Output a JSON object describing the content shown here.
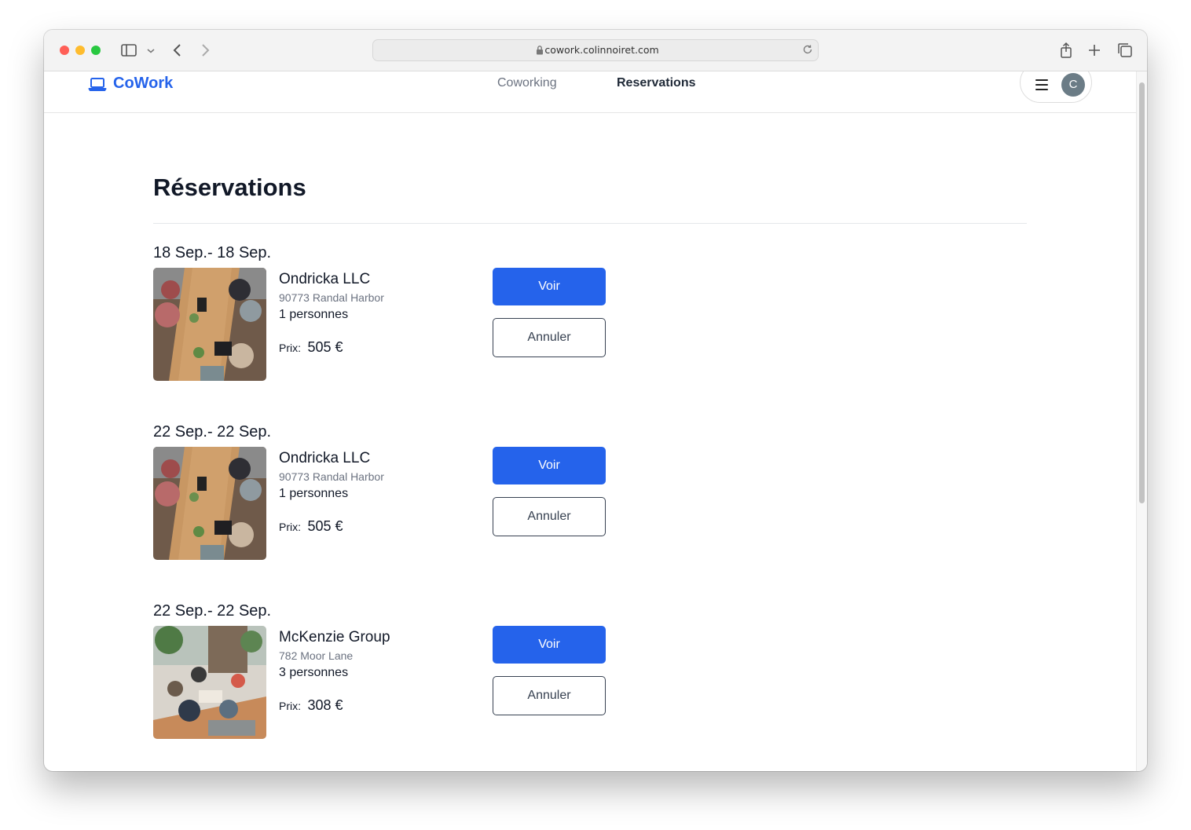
{
  "browser": {
    "url": "cowork.colinnoiret.com"
  },
  "nav": {
    "logo": "CoWork",
    "links": [
      "Coworking",
      "Reservations"
    ],
    "avatar_initial": "C"
  },
  "page": {
    "title": "Réservations"
  },
  "reservations": [
    {
      "date": "18 Sep.- 18 Sep.",
      "name": "Ondricka LLC",
      "address": "90773 Randal Harbor",
      "people": "1 personnes",
      "price_label": "Prix:",
      "price": "505 €",
      "view_label": "Voir",
      "cancel_label": "Annuler",
      "image": "office-table-photo"
    },
    {
      "date": "22 Sep.- 22 Sep.",
      "name": "Ondricka LLC",
      "address": "90773 Randal Harbor",
      "people": "1 personnes",
      "price_label": "Prix:",
      "price": "505 €",
      "view_label": "Voir",
      "cancel_label": "Annuler",
      "image": "office-table-photo"
    },
    {
      "date": "22 Sep.- 22 Sep.",
      "name": "McKenzie Group",
      "address": "782 Moor Lane",
      "people": "3 personnes",
      "price_label": "Prix:",
      "price": "308 €",
      "view_label": "Voir",
      "cancel_label": "Annuler",
      "image": "lounge-meeting-photo"
    }
  ],
  "colors": {
    "accent": "#2563eb",
    "text": "#111827",
    "muted": "#6b7280"
  }
}
